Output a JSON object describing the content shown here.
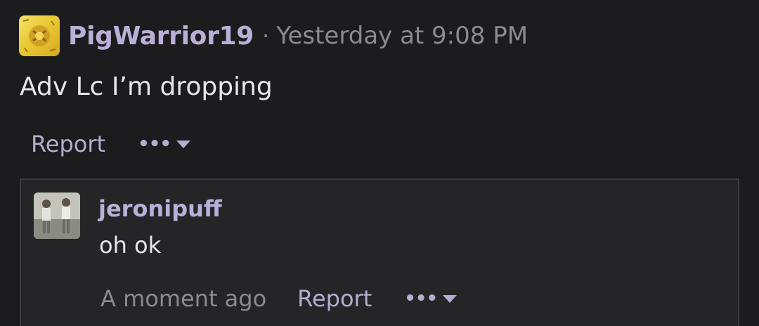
{
  "post": {
    "author": "PigWarrior19",
    "separator": "·",
    "timestamp": "Yesterday at 9:08 PM",
    "body": "Adv Lc I’m dropping",
    "report_label": "Report",
    "more_label": "•••"
  },
  "reply": {
    "author": "jeronipuff",
    "body": "oh ok",
    "timestamp": "A moment ago",
    "report_label": "Report",
    "more_label": "•••"
  },
  "colors": {
    "background": "#1c1b1d",
    "username": "#b9b0d9",
    "muted": "#8b8a8e",
    "action": "#b3aed0",
    "text": "#e8e6ea",
    "reply_background": "#252427"
  },
  "icons": [
    "avatar-image",
    "more-dots-icon",
    "caret-down-icon"
  ]
}
